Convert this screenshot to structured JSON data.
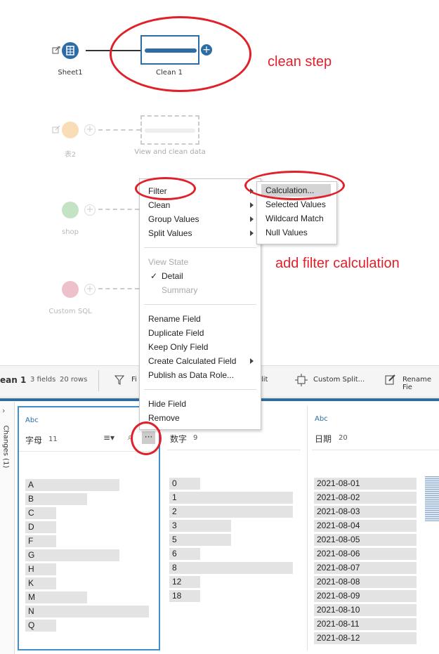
{
  "flow": {
    "nodes": [
      {
        "label": "Sheet1"
      },
      {
        "label": "Clean 1"
      },
      {
        "label": "表2"
      },
      {
        "label": "View and clean data"
      },
      {
        "label": "shop"
      },
      {
        "label": "Custom SQL"
      }
    ]
  },
  "annotations": {
    "clean_step": "clean step",
    "add_filter": "add filter calculation"
  },
  "context_menu": {
    "filter": "Filter",
    "clean": "Clean",
    "group_values": "Group Values",
    "split_values": "Split Values",
    "view_state": "View State",
    "detail": "Detail",
    "summary": "Summary",
    "rename_field": "Rename Field",
    "duplicate_field": "Duplicate Field",
    "keep_only_field": "Keep Only Field",
    "create_calculated_field": "Create Calculated Field",
    "publish_data_role": "Publish as Data Role...",
    "hide_field": "Hide Field",
    "remove": "Remove"
  },
  "submenu": {
    "calculation": "Calculation...",
    "selected_values": "Selected Values",
    "wildcard_match": "Wildcard Match",
    "null_values": "Null Values"
  },
  "toolbar": {
    "step_name": "ean 1",
    "fields": "3 fields",
    "rows": "20 rows",
    "filter_partial": "Fi",
    "split_partial": "lit",
    "custom_split": "Custom Split...",
    "rename_partial": "Rename Fie"
  },
  "side_tab": "Changes (1)",
  "fields": [
    {
      "type": "Abc",
      "name": "字母",
      "count": "11",
      "values": [
        "A",
        "B",
        "C",
        "D",
        "F",
        "G",
        "H",
        "K",
        "M",
        "N",
        "Q"
      ],
      "bars": [
        0.76,
        0.5,
        0.25,
        0.25,
        0.25,
        0.76,
        0.25,
        0.25,
        0.5,
        1.0,
        0.25
      ]
    },
    {
      "type": "",
      "name": "数字",
      "count": "9",
      "values": [
        "0",
        "1",
        "2",
        "3",
        "5",
        "6",
        "8",
        "12",
        "18"
      ],
      "bars": [
        0.25,
        1.0,
        1.0,
        0.5,
        0.5,
        0.25,
        1.0,
        0.25,
        0.25
      ]
    },
    {
      "type": "Abc",
      "name": "日期",
      "count": "20",
      "values": [
        "2021-08-01",
        "2021-08-02",
        "2021-08-03",
        "2021-08-04",
        "2021-08-05",
        "2021-08-06",
        "2021-08-07",
        "2021-08-08",
        "2021-08-09",
        "2021-08-10",
        "2021-08-11",
        "2021-08-12"
      ],
      "bars": [
        1,
        1,
        1,
        1,
        1,
        1,
        1,
        1,
        1,
        1,
        1,
        1
      ]
    }
  ],
  "colors": {
    "accent": "#2e6da4",
    "annotation": "#e0202a",
    "node_blue": "#2e6da4"
  }
}
